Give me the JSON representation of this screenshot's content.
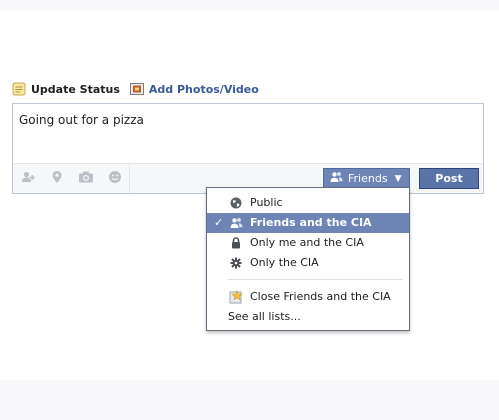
{
  "composer": {
    "tabs": [
      {
        "label": "Update Status",
        "icon": "status-note-icon",
        "active": true
      },
      {
        "label": "Add Photos/Video",
        "icon": "photo-icon",
        "active": false
      }
    ],
    "status_text": "Going out for a pizza",
    "tools": [
      "add-person-icon",
      "location-pin-icon",
      "camera-icon",
      "smiley-icon"
    ],
    "audience_button": {
      "label": "Friends",
      "icon": "friends-icon"
    },
    "post_label": "Post"
  },
  "audience_menu": {
    "items": [
      {
        "label": "Public",
        "icon": "globe-icon",
        "selected": false
      },
      {
        "label": "Friends and the CIA",
        "icon": "friends-icon",
        "selected": true
      },
      {
        "label": "Only me and the CIA",
        "icon": "lock-icon",
        "selected": false
      },
      {
        "label": "Only the CIA",
        "icon": "gear-icon",
        "selected": false
      }
    ],
    "lists": [
      {
        "label": "Close Friends and the CIA",
        "icon": "star-list-icon"
      }
    ],
    "see_all": "See all lists..."
  },
  "colors": {
    "accent": "#6d84b4",
    "link": "#3b5998",
    "post": "#5b74a8"
  }
}
